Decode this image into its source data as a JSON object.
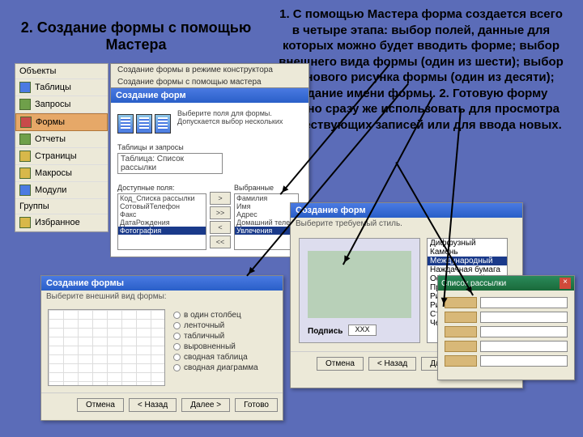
{
  "title_left": "2. Создание формы с помощью Мастера",
  "title_right": "1. С помощью Мастера форма создается всего в четыре этапа: выбор полей, данные для которых можно будет вводить форме; выбор внешнего вида формы (один из шести); выбор фонового рисунка формы (один из десяти); задание имени формы.\n2. Готовую форму можно сразу же использовать для просмотра существующих записей или для ввода новых.",
  "sidebar": [
    "Объекты",
    "Таблицы",
    "Запросы",
    "Формы",
    "Отчеты",
    "Страницы",
    "Макросы",
    "Модули",
    "Группы",
    "Избранное"
  ],
  "obj": {
    "r1": "Создание формы в режиме конструктора",
    "r2": "Создание формы с помощью мастера"
  },
  "wiz1": {
    "title": "Создание форм",
    "hint1": "Выберите поля для формы.",
    "hint2": "Допускается выбор нескольких",
    "tlabel": "Таблицы и запросы",
    "tval": "Таблица: Список рассылки",
    "flabel": "Доступные поля:",
    "slabel": "Выбранные",
    "fields": [
      "Код_Списка рассылки",
      "СотовыйТелефон",
      "Факс",
      "ДатаРождения",
      "Фотография"
    ],
    "selfields": [
      "Фамилия",
      "Имя",
      "Адрес",
      "Домашний телефон",
      "Увлечения"
    ]
  },
  "wiz2": {
    "title": "Создание формы",
    "hint": "Выберите внешний вид формы:",
    "opts": [
      "в один столбец",
      "ленточный",
      "табличный",
      "выровненный",
      "сводная таблица",
      "сводная диаграмма"
    ]
  },
  "wiz3": {
    "title": "Создание форм",
    "hint": "Выберите требуемый стиль.",
    "bg": [
      "Диффузный",
      "Камень",
      "Международный",
      "Наждачная бумага",
      "Официальный",
      "Промышленный",
      "Рисовая бумага",
      "Рисунок Суми",
      "Стандартный",
      "Чертеж"
    ],
    "prevlabel": "Подпись",
    "prevbox": "XXX"
  },
  "wiz4": {
    "title": "Список рассылки"
  },
  "buttons": {
    "cancel": "Отмена",
    "back": "< Назад",
    "next": "Далее >",
    "finish": "Готово"
  }
}
